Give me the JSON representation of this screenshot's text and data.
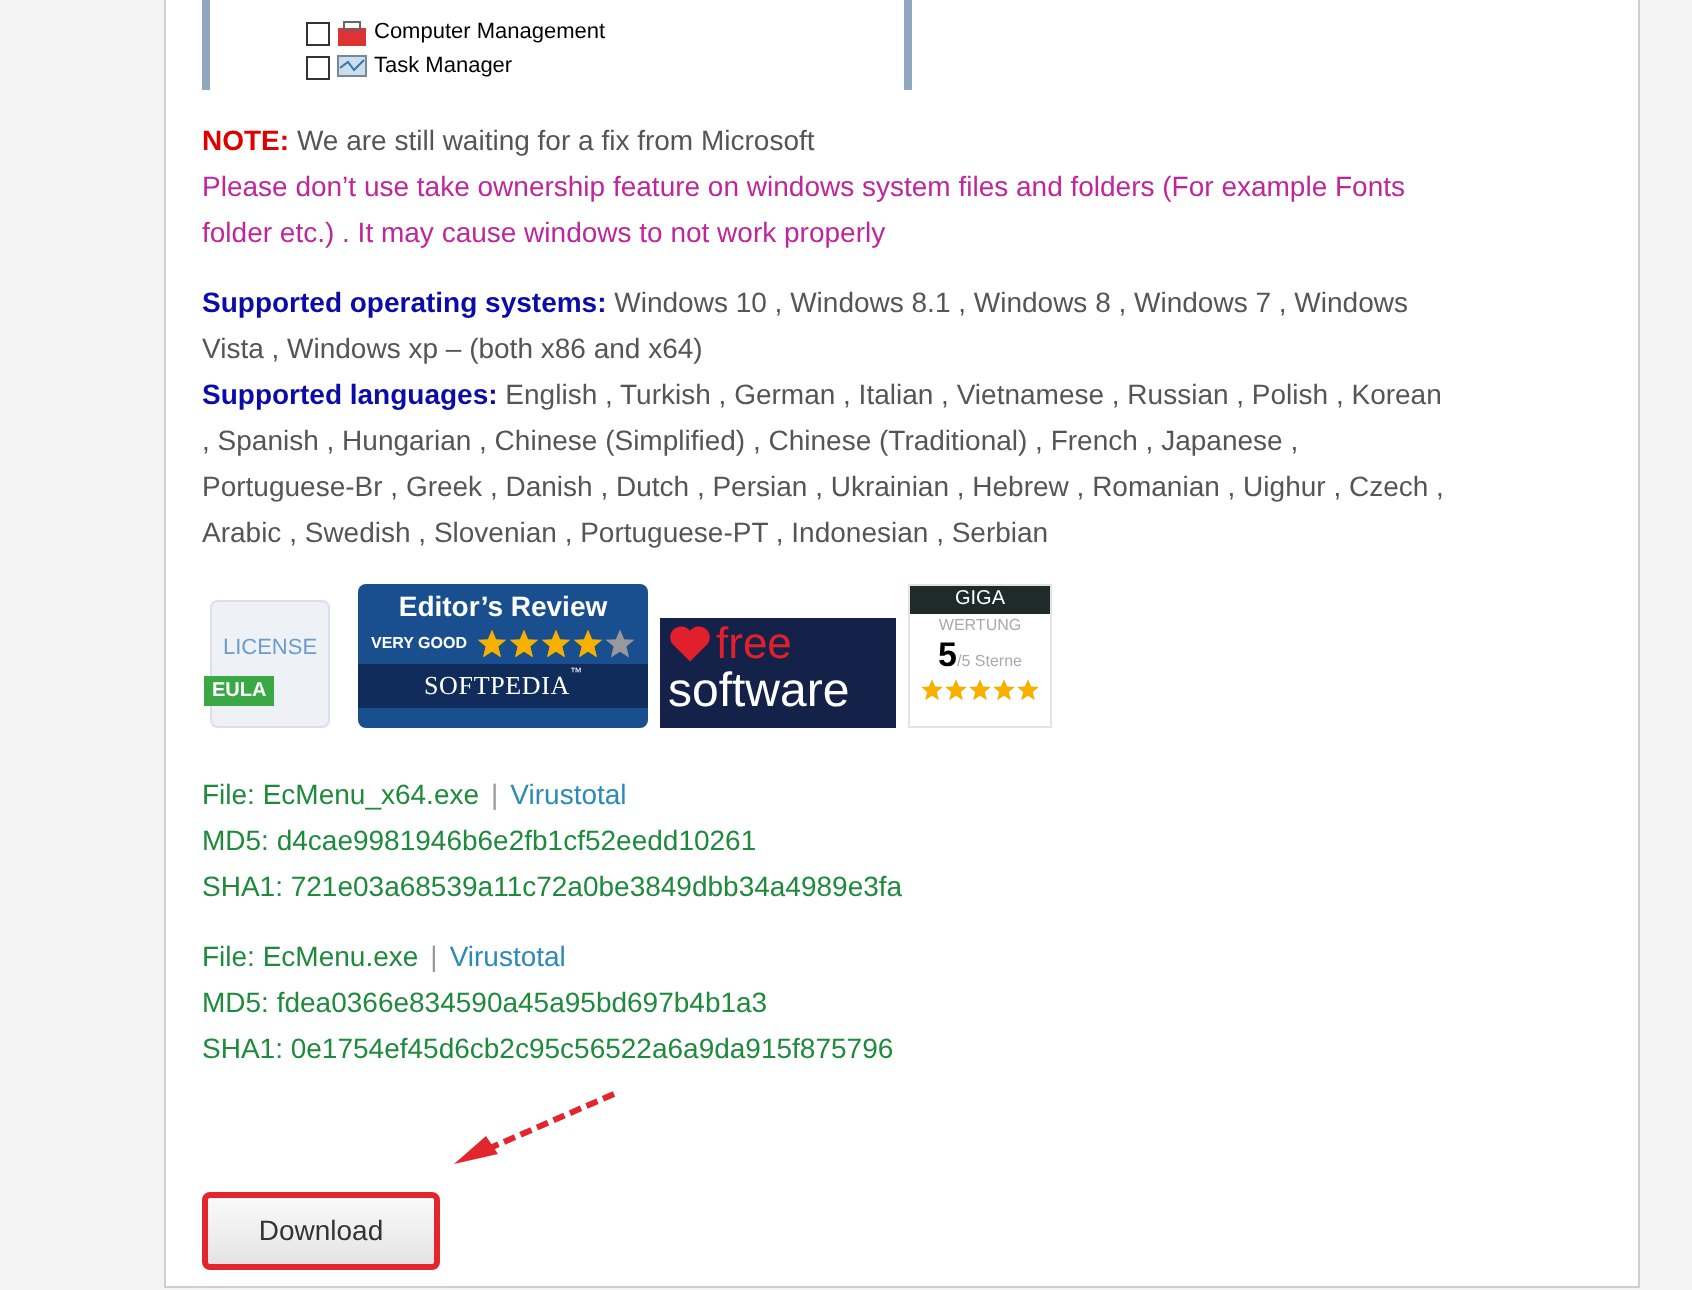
{
  "tree_screenshot": {
    "items": [
      {
        "label": "Computer Management",
        "checked": false
      },
      {
        "label": "Task Manager",
        "checked": false
      }
    ]
  },
  "note": {
    "label": "NOTE:",
    "text": "We are still waiting for a fix from Microsoft"
  },
  "warning": "Please don’t use take ownership feature on windows system files and folders (For example Fonts folder etc.) . It may cause windows to not work properly",
  "supported": [
    {
      "label": "Supported operating systems:",
      "text": "Windows 10 , Windows 8.1 , Windows 8 , Windows 7 , Windows Vista , Windows xp – (both x86 and x64)"
    },
    {
      "label": "Supported languages:",
      "text": "English , Turkish , German , Italian , Vietnamese , Russian , Polish , Korean , Spanish , Hungarian , Chinese (Simplified) , Chinese (Traditional) , French , Japanese , Portuguese-Br , Greek , Danish , Dutch , Persian , Ukrainian , Hebrew , Romanian , Uighur , Czech , Arabic , Swedish , Slovenian , Portuguese-PT , Indonesian , Serbian"
    }
  ],
  "badges": [
    {
      "kind": "license",
      "title": "LICENSE",
      "tag": "EULA"
    },
    {
      "kind": "review",
      "title": "Editor’s Review",
      "rating_label": "VERY GOOD",
      "stars": 4,
      "brand": "SOFTPEDIA",
      "mark": "™"
    },
    {
      "kind": "freesoftware",
      "line1": "free",
      "line2": "software"
    },
    {
      "kind": "giga",
      "brand": "GIGA",
      "title": "WERTUNG",
      "score": "5",
      "scale": "/5 Sterne",
      "stars": 5
    }
  ],
  "files": [
    {
      "file": "File: EcMenu_x64.exe",
      "separator": "|",
      "link": "Virustotal",
      "md5": "MD5: d4cae9981946b6e2fb1cf52eedd10261",
      "sha1": "SHA1: 721e03a68539a11c72a0be3849dbb34a4989e3fa"
    },
    {
      "file": "File: EcMenu.exe",
      "separator": "|",
      "link": "Virustotal",
      "md5": "MD5: fdea0366e834590a45a95bd697b4b1a3",
      "sha1": "SHA1: 0e1754ef45d6cb2c95c56522a6a9da915f875796"
    }
  ],
  "download_button": "Download"
}
